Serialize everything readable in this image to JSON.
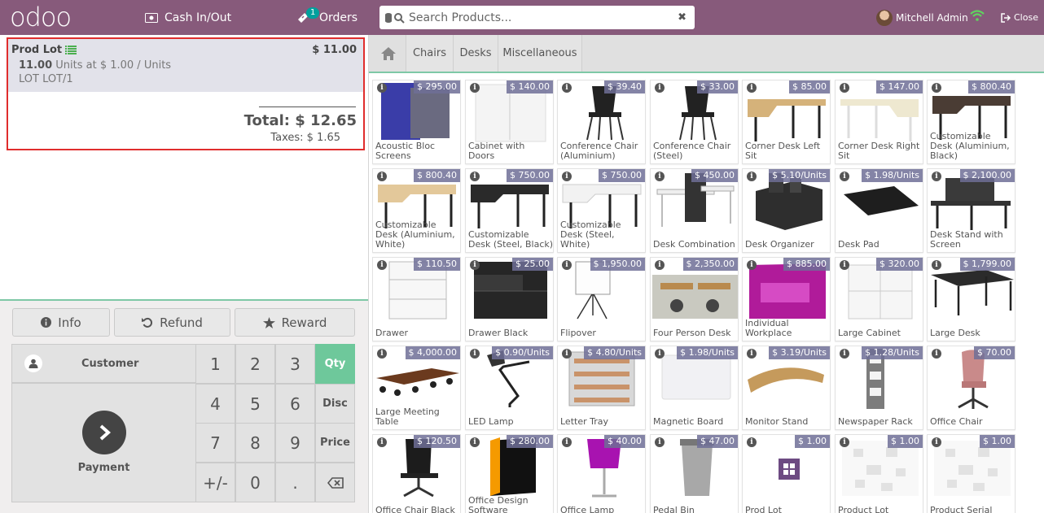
{
  "header": {
    "logo": "odoo",
    "cash_label": "Cash In/Out",
    "orders_label": "Orders",
    "orders_count": "1",
    "search_placeholder": "Search Products...",
    "user_name": "Mitchell Admin",
    "close_label": "Close"
  },
  "colors": {
    "header_bg": "#875a7b",
    "accent_green": "#6ec89b",
    "order_border": "#e02d2d"
  },
  "order": {
    "line": {
      "name": "Prod Lot",
      "price": "$ 11.00",
      "qty": "11.00",
      "unit_detail": "Units at $ 1.00 / Units",
      "lot": "LOT LOT/1"
    },
    "total": "Total: $ 12.65",
    "taxes": "Taxes: $ 1.65"
  },
  "controls": {
    "info": "Info",
    "refund": "Refund",
    "reward": "Reward"
  },
  "numpad": {
    "customer": "Customer",
    "payment": "Payment",
    "keys": [
      "1",
      "2",
      "3",
      "4",
      "5",
      "6",
      "7",
      "8",
      "9",
      "+/-",
      "0",
      "."
    ],
    "qty": "Qty",
    "disc": "Disc",
    "price": "Price"
  },
  "categories": {
    "home_icon": "home-icon",
    "items": [
      "Chairs",
      "Desks",
      "Miscellaneous"
    ]
  },
  "products": [
    {
      "name": "Acoustic Bloc Screens",
      "price": "$ 295.00"
    },
    {
      "name": "Cabinet with Doors",
      "price": "$ 140.00"
    },
    {
      "name": "Conference Chair (Aluminium)",
      "price": "$ 39.40"
    },
    {
      "name": "Conference Chair (Steel)",
      "price": "$ 33.00"
    },
    {
      "name": "Corner Desk Left Sit",
      "price": "$ 85.00"
    },
    {
      "name": "Corner Desk Right Sit",
      "price": "$ 147.00"
    },
    {
      "name": "Customizable Desk (Aluminium, Black)",
      "price": "$ 800.40"
    },
    {
      "name": "Customizable Desk (Aluminium, White)",
      "price": "$ 800.40"
    },
    {
      "name": "Customizable Desk (Steel, Black)",
      "price": "$ 750.00"
    },
    {
      "name": "Customizable Desk (Steel, White)",
      "price": "$ 750.00"
    },
    {
      "name": "Desk Combination",
      "price": "$ 450.00"
    },
    {
      "name": "Desk Organizer",
      "price": "$ 5.10/Units"
    },
    {
      "name": "Desk Pad",
      "price": "$ 1.98/Units"
    },
    {
      "name": "Desk Stand with Screen",
      "price": "$ 2,100.00"
    },
    {
      "name": "Drawer",
      "price": "$ 110.50"
    },
    {
      "name": "Drawer Black",
      "price": "$ 25.00"
    },
    {
      "name": "Flipover",
      "price": "$ 1,950.00"
    },
    {
      "name": "Four Person Desk",
      "price": "$ 2,350.00"
    },
    {
      "name": "Individual Workplace",
      "price": "$ 885.00"
    },
    {
      "name": "Large Cabinet",
      "price": "$ 320.00"
    },
    {
      "name": "Large Desk",
      "price": "$ 1,799.00"
    },
    {
      "name": "Large Meeting Table",
      "price": "$ 4,000.00"
    },
    {
      "name": "LED Lamp",
      "price": "$ 0.90/Units"
    },
    {
      "name": "Letter Tray",
      "price": "$ 4.80/Units"
    },
    {
      "name": "Magnetic Board",
      "price": "$ 1.98/Units"
    },
    {
      "name": "Monitor Stand",
      "price": "$ 3.19/Units"
    },
    {
      "name": "Newspaper Rack",
      "price": "$ 1.28/Units"
    },
    {
      "name": "Office Chair",
      "price": "$ 70.00"
    },
    {
      "name": "Office Chair Black",
      "price": "$ 120.50"
    },
    {
      "name": "Office Design Software",
      "price": "$ 280.00"
    },
    {
      "name": "Office Lamp",
      "price": "$ 40.00"
    },
    {
      "name": "Pedal Bin",
      "price": "$ 47.00"
    },
    {
      "name": "Prod Lot",
      "price": "$ 1.00"
    },
    {
      "name": "Product Lot",
      "price": "$ 1.00"
    },
    {
      "name": "Product Serial",
      "price": "$ 1.00"
    }
  ]
}
